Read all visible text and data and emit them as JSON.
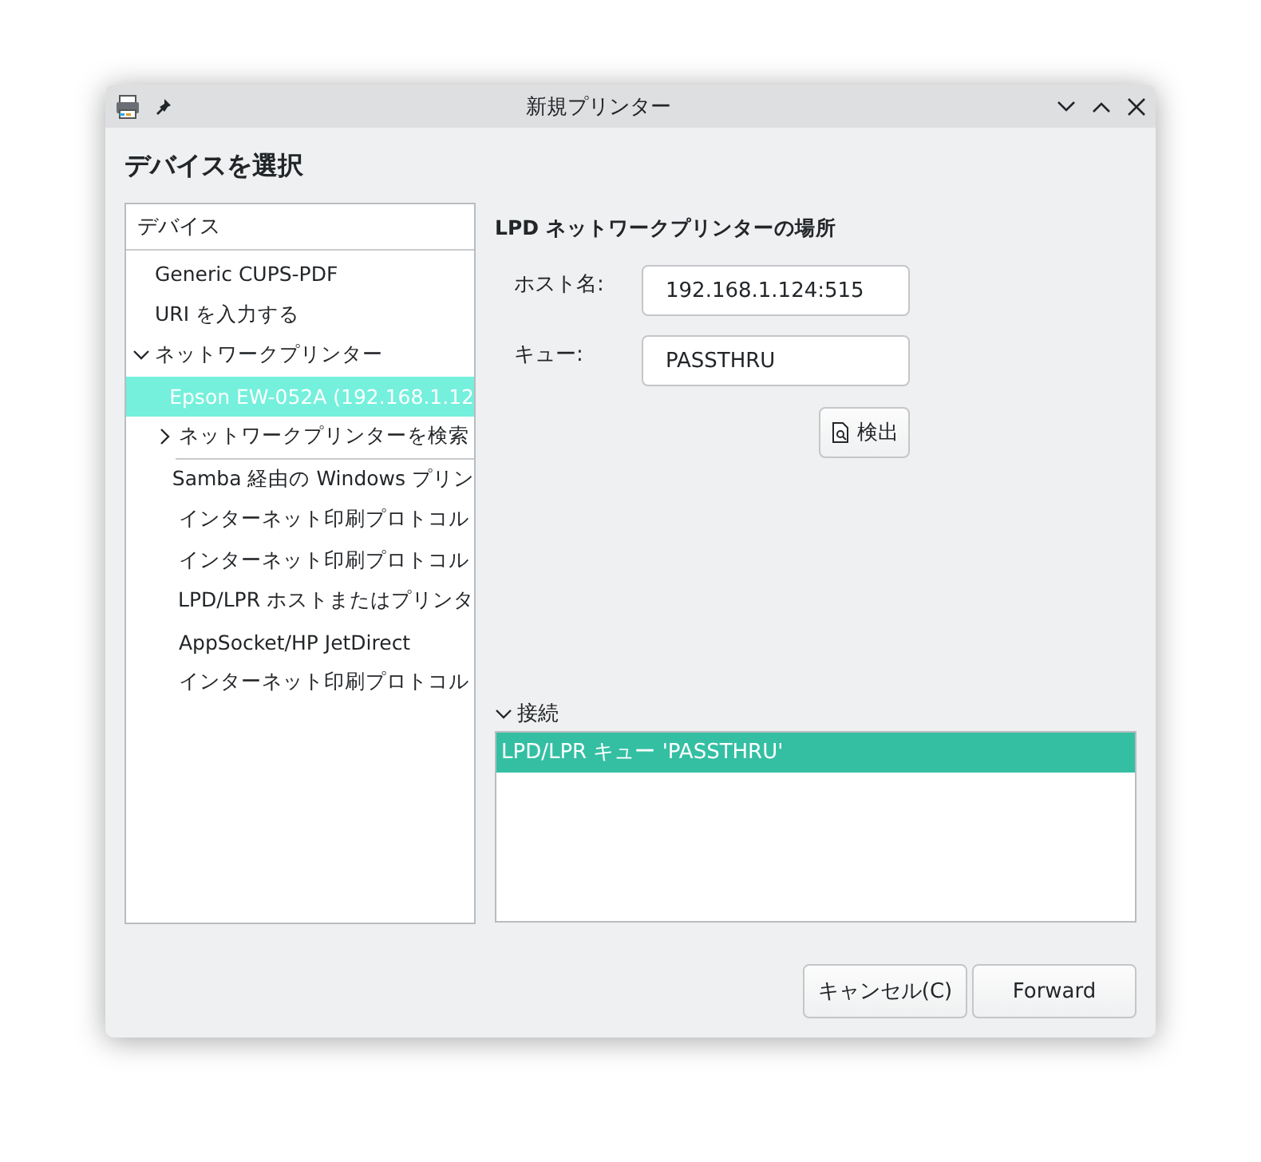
{
  "window": {
    "title": "新規プリンター"
  },
  "heading": "デバイスを選択",
  "device_tree": {
    "header": "デバイス",
    "items": [
      {
        "label": "Generic CUPS-PDF",
        "kind": "device",
        "selected": false
      },
      {
        "label": "URI を入力する",
        "kind": "device",
        "selected": false
      },
      {
        "label": "ネットワークプリンター",
        "kind": "device",
        "selected": false,
        "expanded": true,
        "children": [
          {
            "label": "Epson EW-052A (192.168.1.12",
            "kind": "device",
            "selected": true
          },
          {
            "label": "ネットワークプリンターを検索",
            "kind": "device",
            "selected": false,
            "expanded": false
          }
        ]
      },
      {
        "kind": "separator"
      },
      {
        "label": "Samba 経由の Windows プリン",
        "kind": "method",
        "selected": false
      },
      {
        "label": "インターネット印刷プロトコル",
        "kind": "method",
        "selected": false
      },
      {
        "label": "インターネット印刷プロトコル",
        "kind": "method",
        "selected": false
      },
      {
        "label": "LPD/LPR ホストまたはプリンタ",
        "kind": "method",
        "selected": false
      },
      {
        "label": "AppSocket/HP JetDirect",
        "kind": "method",
        "selected": false
      },
      {
        "label": "インターネット印刷プロトコル",
        "kind": "method",
        "selected": false
      }
    ]
  },
  "location": {
    "title": "LPD ネットワークプリンターの場所",
    "fields": [
      {
        "label": "ホスト名:",
        "value": "192.168.1.124:515"
      },
      {
        "label": "キュー:",
        "value": "PASSTHRU"
      }
    ],
    "detect_button": "検出"
  },
  "connection": {
    "label": "接続",
    "expanded": true,
    "items": [
      {
        "label": "LPD/LPR キュー 'PASSTHRU'",
        "selected": true
      }
    ]
  },
  "buttons": [
    {
      "label": "キャンセル(C)"
    },
    {
      "label": "Forward"
    }
  ]
}
